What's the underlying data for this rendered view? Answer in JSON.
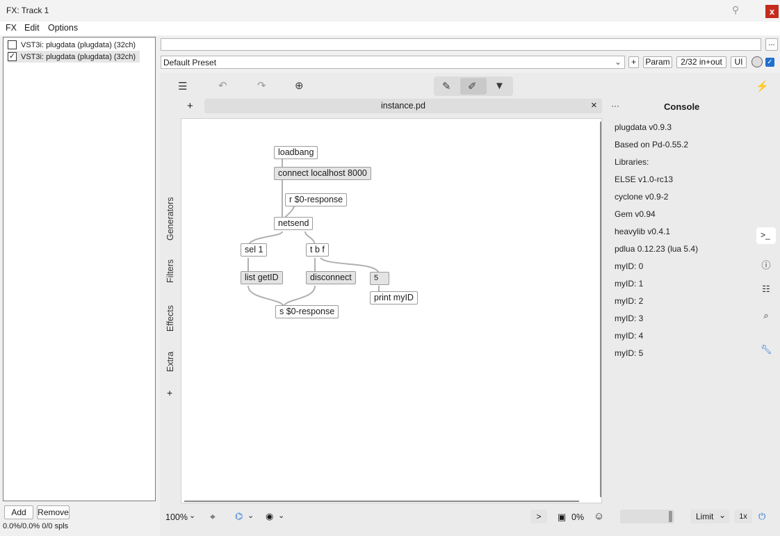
{
  "window": {
    "title": "FX: Track 1",
    "pin_icon": "pin-icon",
    "close_label": "x"
  },
  "menu": [
    "FX",
    "Edit",
    "Options"
  ],
  "fx_list": [
    {
      "label": "VST3i: plugdata (plugdata) (32ch)",
      "checked": false,
      "check": ""
    },
    {
      "label": "VST3i: plugdata (plugdata) (32ch)",
      "checked": true,
      "check": "✓"
    }
  ],
  "buttons": {
    "add": "Add",
    "remove": "Remove",
    "dots": "...",
    "plus": "+",
    "param": "Param",
    "io": "2/32 in+out",
    "ui": "UI"
  },
  "status": "0.0%/0.0% 0/0 spls",
  "preset": {
    "value": "Default Preset"
  },
  "pd": {
    "tab_title": "instance.pd",
    "tab_add": "+",
    "tab_close": "×",
    "side_tabs": [
      "Generators",
      "Filters",
      "Effects",
      "Extra"
    ],
    "side_add": "+",
    "objects": [
      {
        "text": "loadbang",
        "msg": false
      },
      {
        "text": "connect localhost 8000",
        "msg": true
      },
      {
        "text": "r $0-response",
        "msg": false
      },
      {
        "text": "netsend",
        "msg": false
      },
      {
        "text": "sel 1",
        "msg": false
      },
      {
        "text": "t b f",
        "msg": false
      },
      {
        "text": "list getID",
        "msg": true
      },
      {
        "text": "disconnect",
        "msg": true
      },
      {
        "text": "5",
        "msg": true
      },
      {
        "text": "print myID",
        "msg": false
      },
      {
        "text": "s $0-response",
        "msg": false
      }
    ],
    "console": {
      "title": "Console",
      "menu": "···",
      "lines": [
        "plugdata v0.9.3",
        "Based on Pd-0.55.2",
        "Libraries:",
        "ELSE v1.0-rc13",
        "cyclone v0.9-2",
        "Gem v0.94",
        "heavylib v0.4.1",
        "pdlua 0.12.23 (lua 5.4)",
        "myID: 0",
        "myID: 1",
        "myID: 2",
        "myID: 3",
        "myID: 4",
        "myID: 5"
      ]
    },
    "bottom": {
      "zoom": "100%",
      "dsp_toggle": ">",
      "cpu": "0%",
      "limit": "Limit",
      "oversample": "1x"
    },
    "accent": "#1f6fd0"
  }
}
